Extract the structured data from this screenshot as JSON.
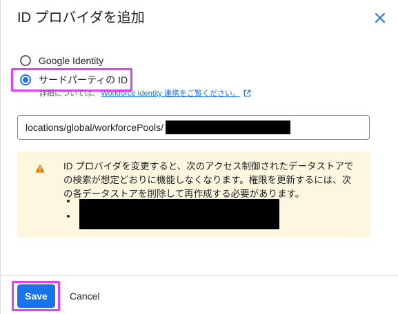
{
  "dialog": {
    "title": "ID プロバイダを追加"
  },
  "provider_options": [
    {
      "label": "Google Identity",
      "selected": false
    },
    {
      "label": "サードパーティの ID",
      "selected": true
    }
  ],
  "helper": {
    "prefix": "詳細については、",
    "link_text": "Workforce Identity 連携をご覧ください。"
  },
  "pool_input": {
    "value": "locations/global/workforcePools/"
  },
  "warning": {
    "text": "ID プロバイダを変更すると、次のアクセス制御されたデータストアでの検索が想定どおりに機能しなくなります。権限を更新するには、次の各データストアを削除して再作成する必要があります。"
  },
  "footer": {
    "save_label": "Save",
    "cancel_label": "Cancel"
  },
  "colors": {
    "accent": "#1a73e8",
    "warning_bg": "#fef7e0",
    "warning_icon": "#e37400",
    "annotation_highlight": "#e040fb"
  }
}
